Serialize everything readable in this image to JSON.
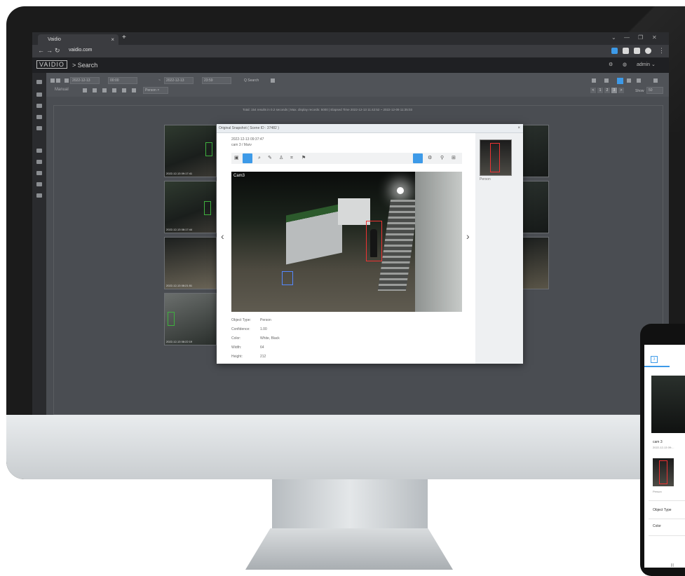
{
  "browser": {
    "tab_title": "Vaidio",
    "tab_close": "×",
    "new_tab": "+",
    "url": "vaidio.com",
    "window_controls": [
      "⌄",
      "—",
      "❐",
      "✕"
    ]
  },
  "app": {
    "logo": "VAIDIO",
    "breadcrumb": "> Search",
    "user": "admin",
    "user_caret": "⌄"
  },
  "toolbar": {
    "date_from": "2022-12-13",
    "time_from": "00:00",
    "range_sep": "~",
    "date_to": "2022-12-13",
    "time_to": "23:59",
    "search_label": "Q Search",
    "mode": "Manual",
    "filter_chip": "Person ×",
    "pages": [
      "<",
      "1",
      "2",
      "3",
      ">"
    ],
    "active_page": "3",
    "show_label": "Show",
    "show_value": "50"
  },
  "results": {
    "summary": "Total: 154 results in 0.2 seconds | Max. display records: 5000 | Elapsed Time 2022-12-13 11:42:52 ~ 2022-12-09 11:35:03"
  },
  "thumbnails": [
    {
      "timestamp": "2022-12-13 09:17:41"
    },
    {
      "timestamp": "2022-12-13 08:17:44"
    },
    {
      "timestamp": "2022-12-13 08:21:51"
    },
    {
      "timestamp": "2022-12-13 08:22:19"
    }
  ],
  "modal": {
    "title": "Original Snapshot ( Scene ID : 37482 )",
    "close": "×",
    "datetime": "2022-12-13 09:37:47",
    "camera": "cam 3  /  Marv",
    "camera_overlay": "Cam3",
    "prev": "‹",
    "next": "›",
    "attributes": [
      {
        "key": "Object Type:",
        "value": "Person"
      },
      {
        "key": "Confidence:",
        "value": "1.00"
      },
      {
        "key": "Color:",
        "value": "White, Black"
      },
      {
        "key": "Width:",
        "value": "64"
      },
      {
        "key": "Height:",
        "value": "212"
      }
    ],
    "side_label": "Person"
  },
  "phone": {
    "tab_icon": "3",
    "camera": "cam 3",
    "date": "2022-12-13 09:...",
    "object_label": "Person",
    "rows": [
      "Object Type",
      "Color"
    ],
    "home": "|||"
  },
  "colors": {
    "accent": "#3d9ae8",
    "detection_box": "#e33333",
    "thumb_box": "#3fb13f"
  }
}
